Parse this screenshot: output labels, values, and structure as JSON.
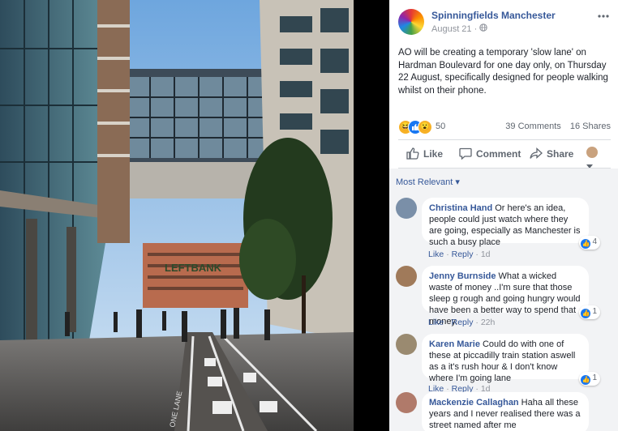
{
  "page": {
    "name": "Spinningfields Manchester",
    "date": "August 21",
    "privacy_icon": "globe-icon",
    "more_icon": "ellipsis-icon"
  },
  "post": {
    "text": "AO will be creating a temporary 'slow lane' on Hardman Boulevard for one day only, on Thursday 22 August, specifically designed for people walking whilst on their phone."
  },
  "photo": {
    "sign_text": "LEFTBANK",
    "lane_text": "ONE LANE"
  },
  "reactions": {
    "count": "50",
    "comments": "39 Comments",
    "shares": "16 Shares"
  },
  "actions": {
    "like": "Like",
    "comment": "Comment",
    "share": "Share"
  },
  "comments_header": {
    "sort_label": "Most Relevant"
  },
  "comments": [
    {
      "name": "Christina Hand",
      "text": "Or here's an idea, people could just watch where they are going, especially as Manchester is such a busy place",
      "likes": "4",
      "like_label": "Like",
      "reply_label": "Reply",
      "time": "1d",
      "avatar_color": "#7a8fa8"
    },
    {
      "name": "Jenny Burnside",
      "text": "What a wicked waste of money ..I'm sure that those sleep g rough and going hungry would have been a better way to spend that money.",
      "likes": "1",
      "like_label": "Like",
      "reply_label": "Reply",
      "time": "22h",
      "avatar_color": "#a07a5a"
    },
    {
      "name": "Karen Marie",
      "text": "Could do with one of these at piccadilly train station aswell as a it's rush hour & I don't know where I'm going lane",
      "likes": "1",
      "like_label": "Like",
      "reply_label": "Reply",
      "time": "1d",
      "avatar_color": "#9a8a70"
    },
    {
      "name": "Mackenzie Callaghan",
      "text": "Haha all these years and I never realised there was a street named after me",
      "likes": "",
      "like_label": "",
      "reply_label": "",
      "time": "",
      "avatar_color": "#b07a6a"
    }
  ],
  "separators": {
    "meta_dot": "·",
    "link_dot": "·",
    "sort_caret": "▾"
  }
}
